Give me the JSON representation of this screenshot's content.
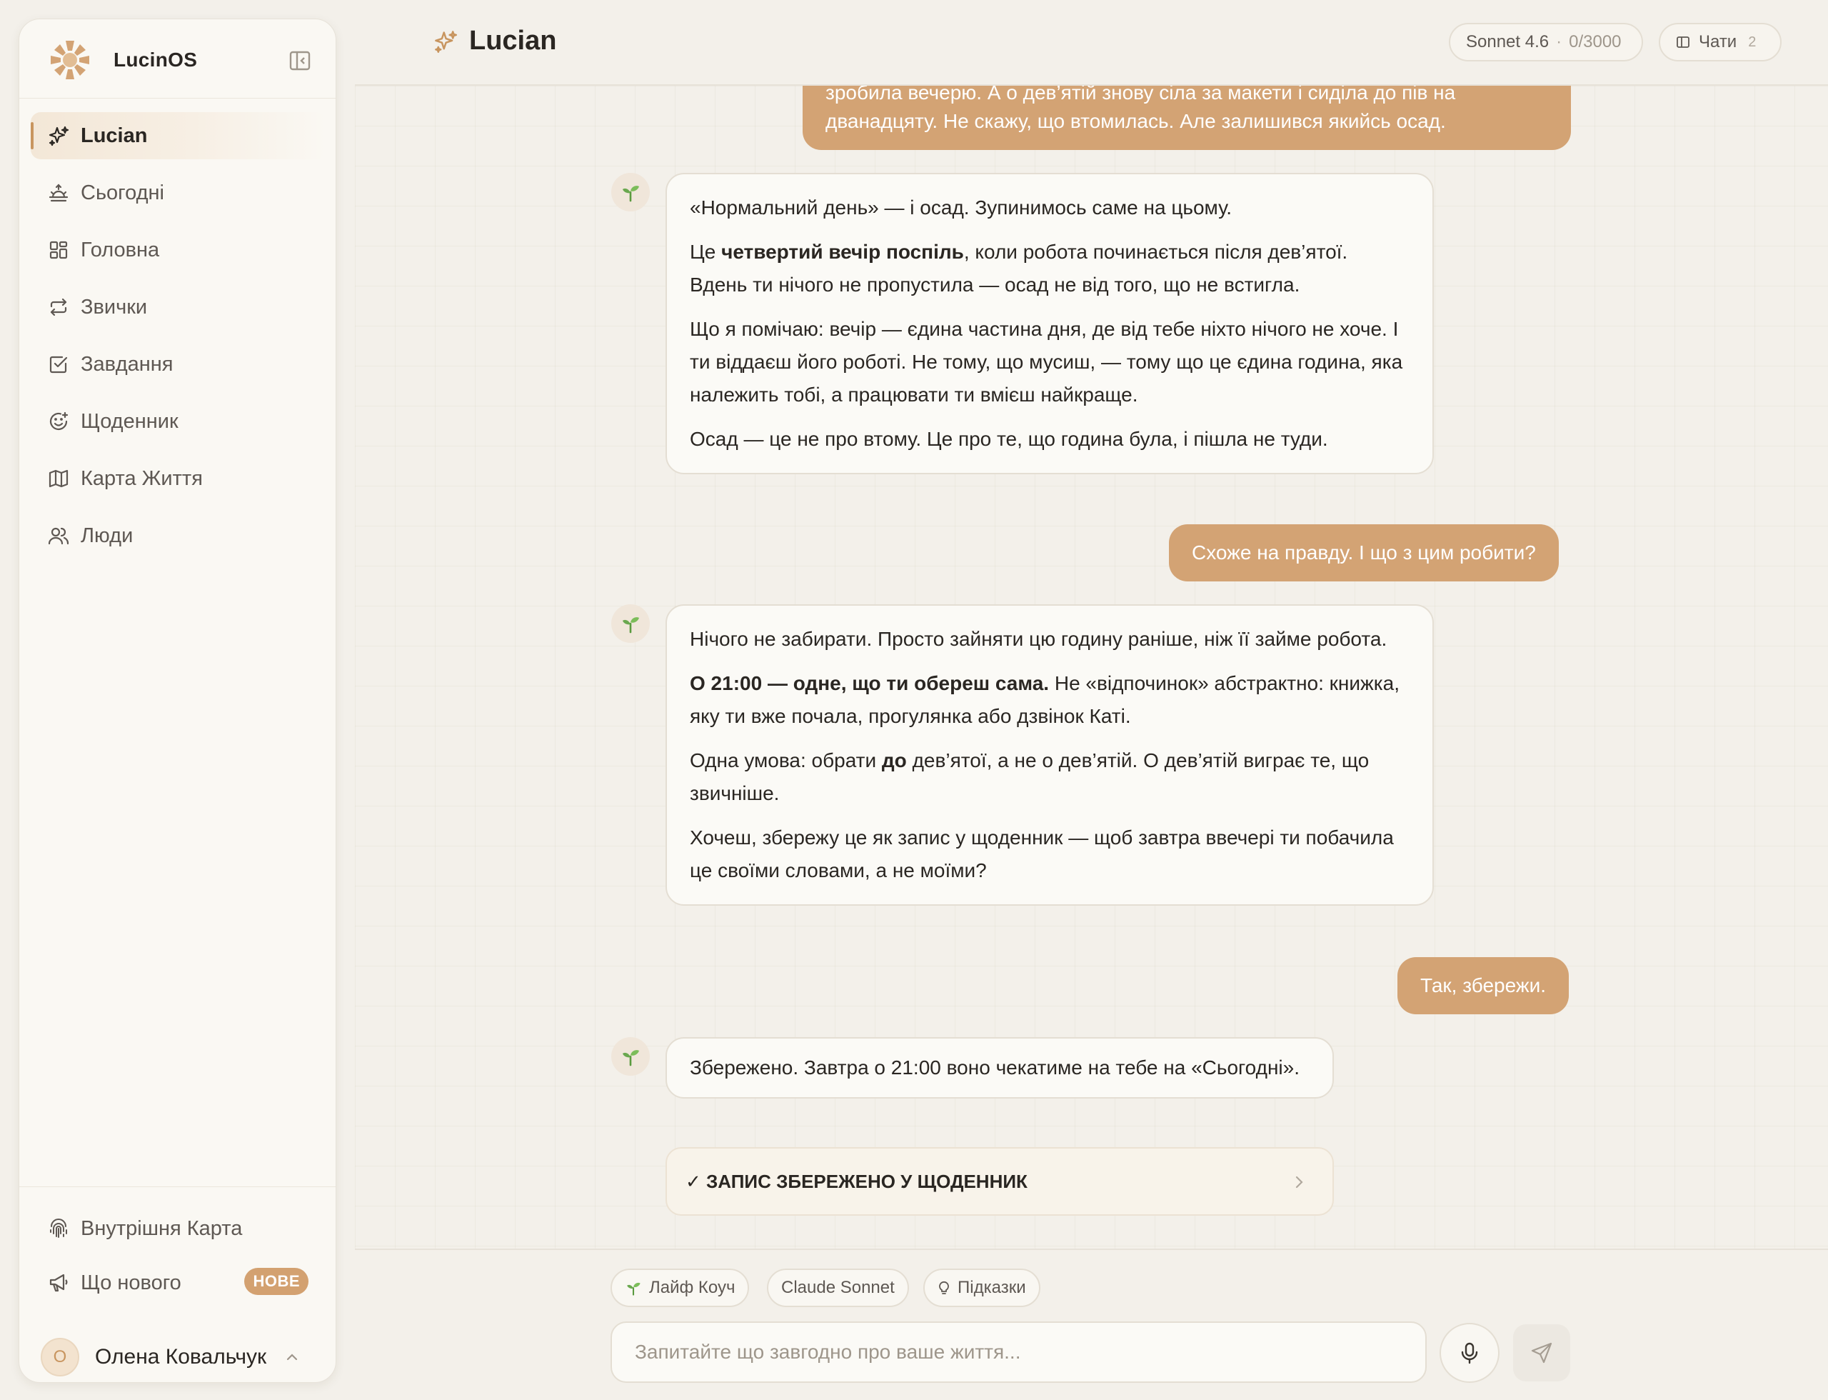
{
  "app": {
    "name": "LucinOS"
  },
  "sidebar": {
    "items": [
      {
        "label": "Lucian",
        "icon": "sparkles-icon",
        "active": true
      },
      {
        "label": "Сьогодні",
        "icon": "sunrise-icon"
      },
      {
        "label": "Головна",
        "icon": "dashboard-icon"
      },
      {
        "label": "Звички",
        "icon": "repeat-icon"
      },
      {
        "label": "Завдання",
        "icon": "checkbox-icon"
      },
      {
        "label": "Щоденник",
        "icon": "smile-icon"
      },
      {
        "label": "Карта Життя",
        "icon": "map-icon"
      },
      {
        "label": "Люди",
        "icon": "users-icon"
      }
    ],
    "bottom": [
      {
        "label": "Внутрішня Карта",
        "icon": "fingerprint-icon"
      },
      {
        "label": "Що нового",
        "icon": "megaphone-icon",
        "badge": "НОВЕ"
      }
    ],
    "user": {
      "initial": "О",
      "name": "Олена Ковальчук"
    }
  },
  "header": {
    "title": "Lucian",
    "model": "Sonnet 4.6",
    "usage": "0/3000",
    "chats_label": "Чати",
    "chats_count": "2"
  },
  "messages": {
    "user1_line1": "зробила вечерю. А о дев’ятій знову сіла за макети і сиділа до пів на",
    "user1_line2": "дванадцяту. Не скажу, що втомилась. Але залишився якийсь осад.",
    "ai1_p1": "«Нормальний день» — і осад. Зупинимось саме на цьому.",
    "ai1_p2_pre": "Це ",
    "ai1_p2_bold": "четвертий вечір поспіль",
    "ai1_p2_post": ", коли робота починається після дев’ятої. Вдень ти нічого не пропустила — осад не від того, що не встигла.",
    "ai1_p3": "Що я помічаю: вечір — єдина частина дня, де від тебе ніхто нічого не хоче. І ти віддаєш його роботі. Не тому, що мусиш, — тому що це єдина година, яка належить тобі, а працювати ти вмієш найкраще.",
    "ai1_p4": "Осад — це не про втому. Це про те, що година була, і пішла не туди.",
    "user2": "Схоже на правду. І що з цим робити?",
    "ai2_p1": "Нічого не забирати. Просто зайняти цю годину раніше, ніж її займе робота.",
    "ai2_p2_bold": "О 21:00 — одне, що ти обереш сама.",
    "ai2_p2_post": " Не «відпочинок» абстрактно: книжка, яку ти вже почала, прогулянка або дзвінок Каті.",
    "ai2_p3_pre": "Одна умова: обрати ",
    "ai2_p3_bold": "до",
    "ai2_p3_post": " дев’ятої, а не о дев’ятій. О дев’ятій виграє те, що звичніше.",
    "ai2_p4": "Хочеш, збережу це як запис у щоденник — щоб завтра ввечері ти побачила це своїми словами, а не моїми?",
    "user3": "Так, збережи.",
    "ai3": "Збережено. Завтра о 21:00 воно чекатиме на тебе на «Сьогодні».",
    "saved_card": "✓ ЗАПИС ЗБЕРЕЖЕНО У ЩОДЕННИК"
  },
  "composer": {
    "chips": [
      "Лайф Коуч",
      "Claude Sonnet",
      "Підказки"
    ],
    "placeholder": "Запитайте що завгодно про ваше життя..."
  },
  "colors": {
    "accent": "#d3a374",
    "background": "#f3f0ea",
    "card": "#fbfaf6",
    "sprout": "#6aa84f"
  }
}
